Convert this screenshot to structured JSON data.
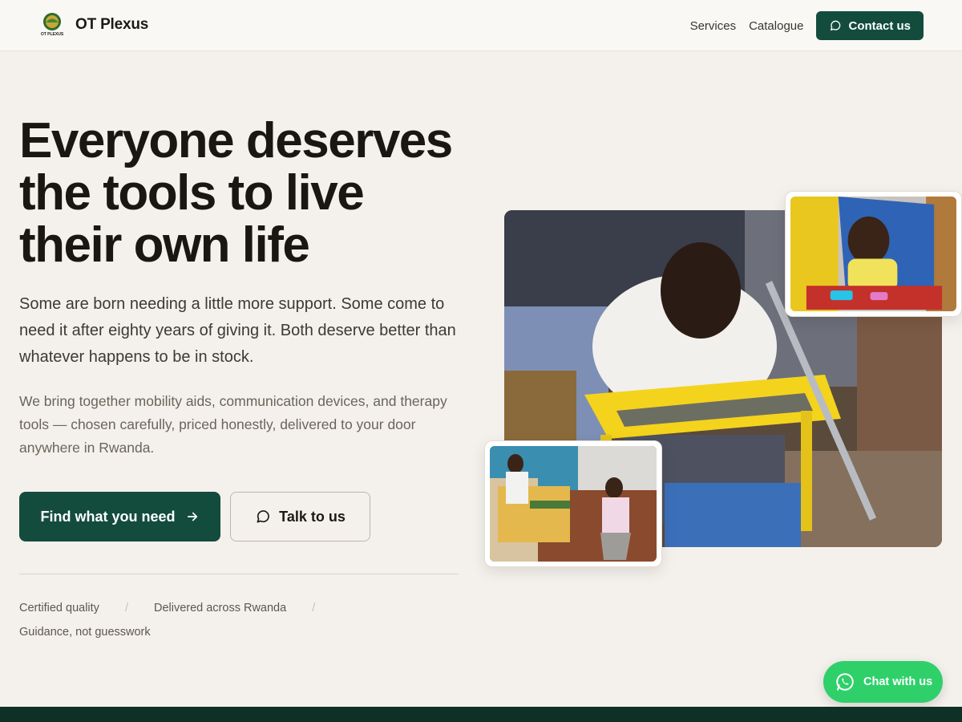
{
  "header": {
    "brand_name": "OT Plexus",
    "logo_text": "OT PLEXUS",
    "nav": {
      "services": "Services",
      "catalogue": "Catalogue"
    },
    "contact_label": "Contact us"
  },
  "hero": {
    "headline": "Everyone deserves the tools to live their own life",
    "lead": "Some are born needing a little more support. Some come to need it after eighty years of giving it. Both deserve better than whatever happens to be in stock.",
    "sub": "We bring together mobility aids, communication devices, and therapy tools — chosen carefully, priced honestly, delivered to your door anywhere in Rwanda.",
    "primary_cta": "Find what you need",
    "secondary_cta": "Talk to us",
    "trust": [
      "Certified quality",
      "Delivered across Rwanda",
      "Guidance, not guesswork"
    ],
    "separator": "/"
  },
  "chat": {
    "label": "Chat with us"
  },
  "colors": {
    "background": "#f4f1ec",
    "brand_green": "#134c3d",
    "whatsapp_green": "#2fd06a",
    "footer": "#0f3026"
  },
  "icons": {
    "contact": "chat-bubble-icon",
    "primary_cta": "arrow-right-icon",
    "secondary_cta": "chat-bubble-icon",
    "chat": "whatsapp-icon"
  }
}
